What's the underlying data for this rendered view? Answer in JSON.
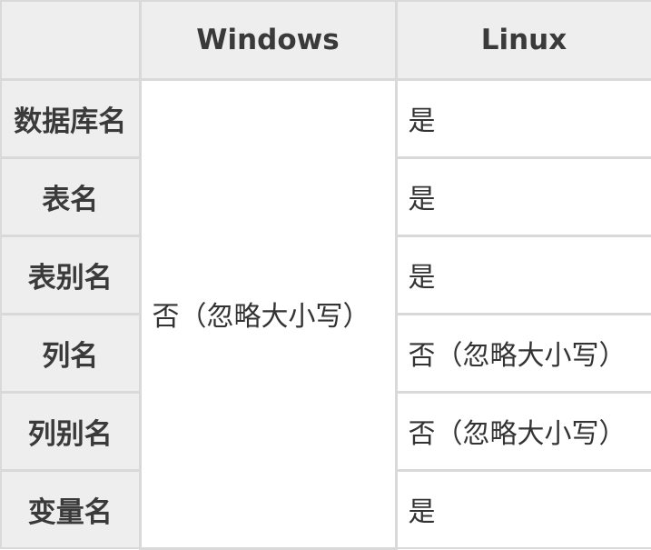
{
  "table": {
    "headers": [
      "",
      "Windows",
      "Linux"
    ],
    "windows_value": "否（忽略大小写）",
    "rows": [
      {
        "label": "数据库名",
        "linux": "是"
      },
      {
        "label": "表名",
        "linux": "是"
      },
      {
        "label": "表别名",
        "linux": "是"
      },
      {
        "label": "列名",
        "linux": "否（忽略大小写）"
      },
      {
        "label": "列别名",
        "linux": "否（忽略大小写）"
      },
      {
        "label": "变量名",
        "linux": "是"
      }
    ]
  },
  "colors": {
    "header_bg": "#eeeeee",
    "border": "#d9d9d9",
    "text": "#333333"
  }
}
